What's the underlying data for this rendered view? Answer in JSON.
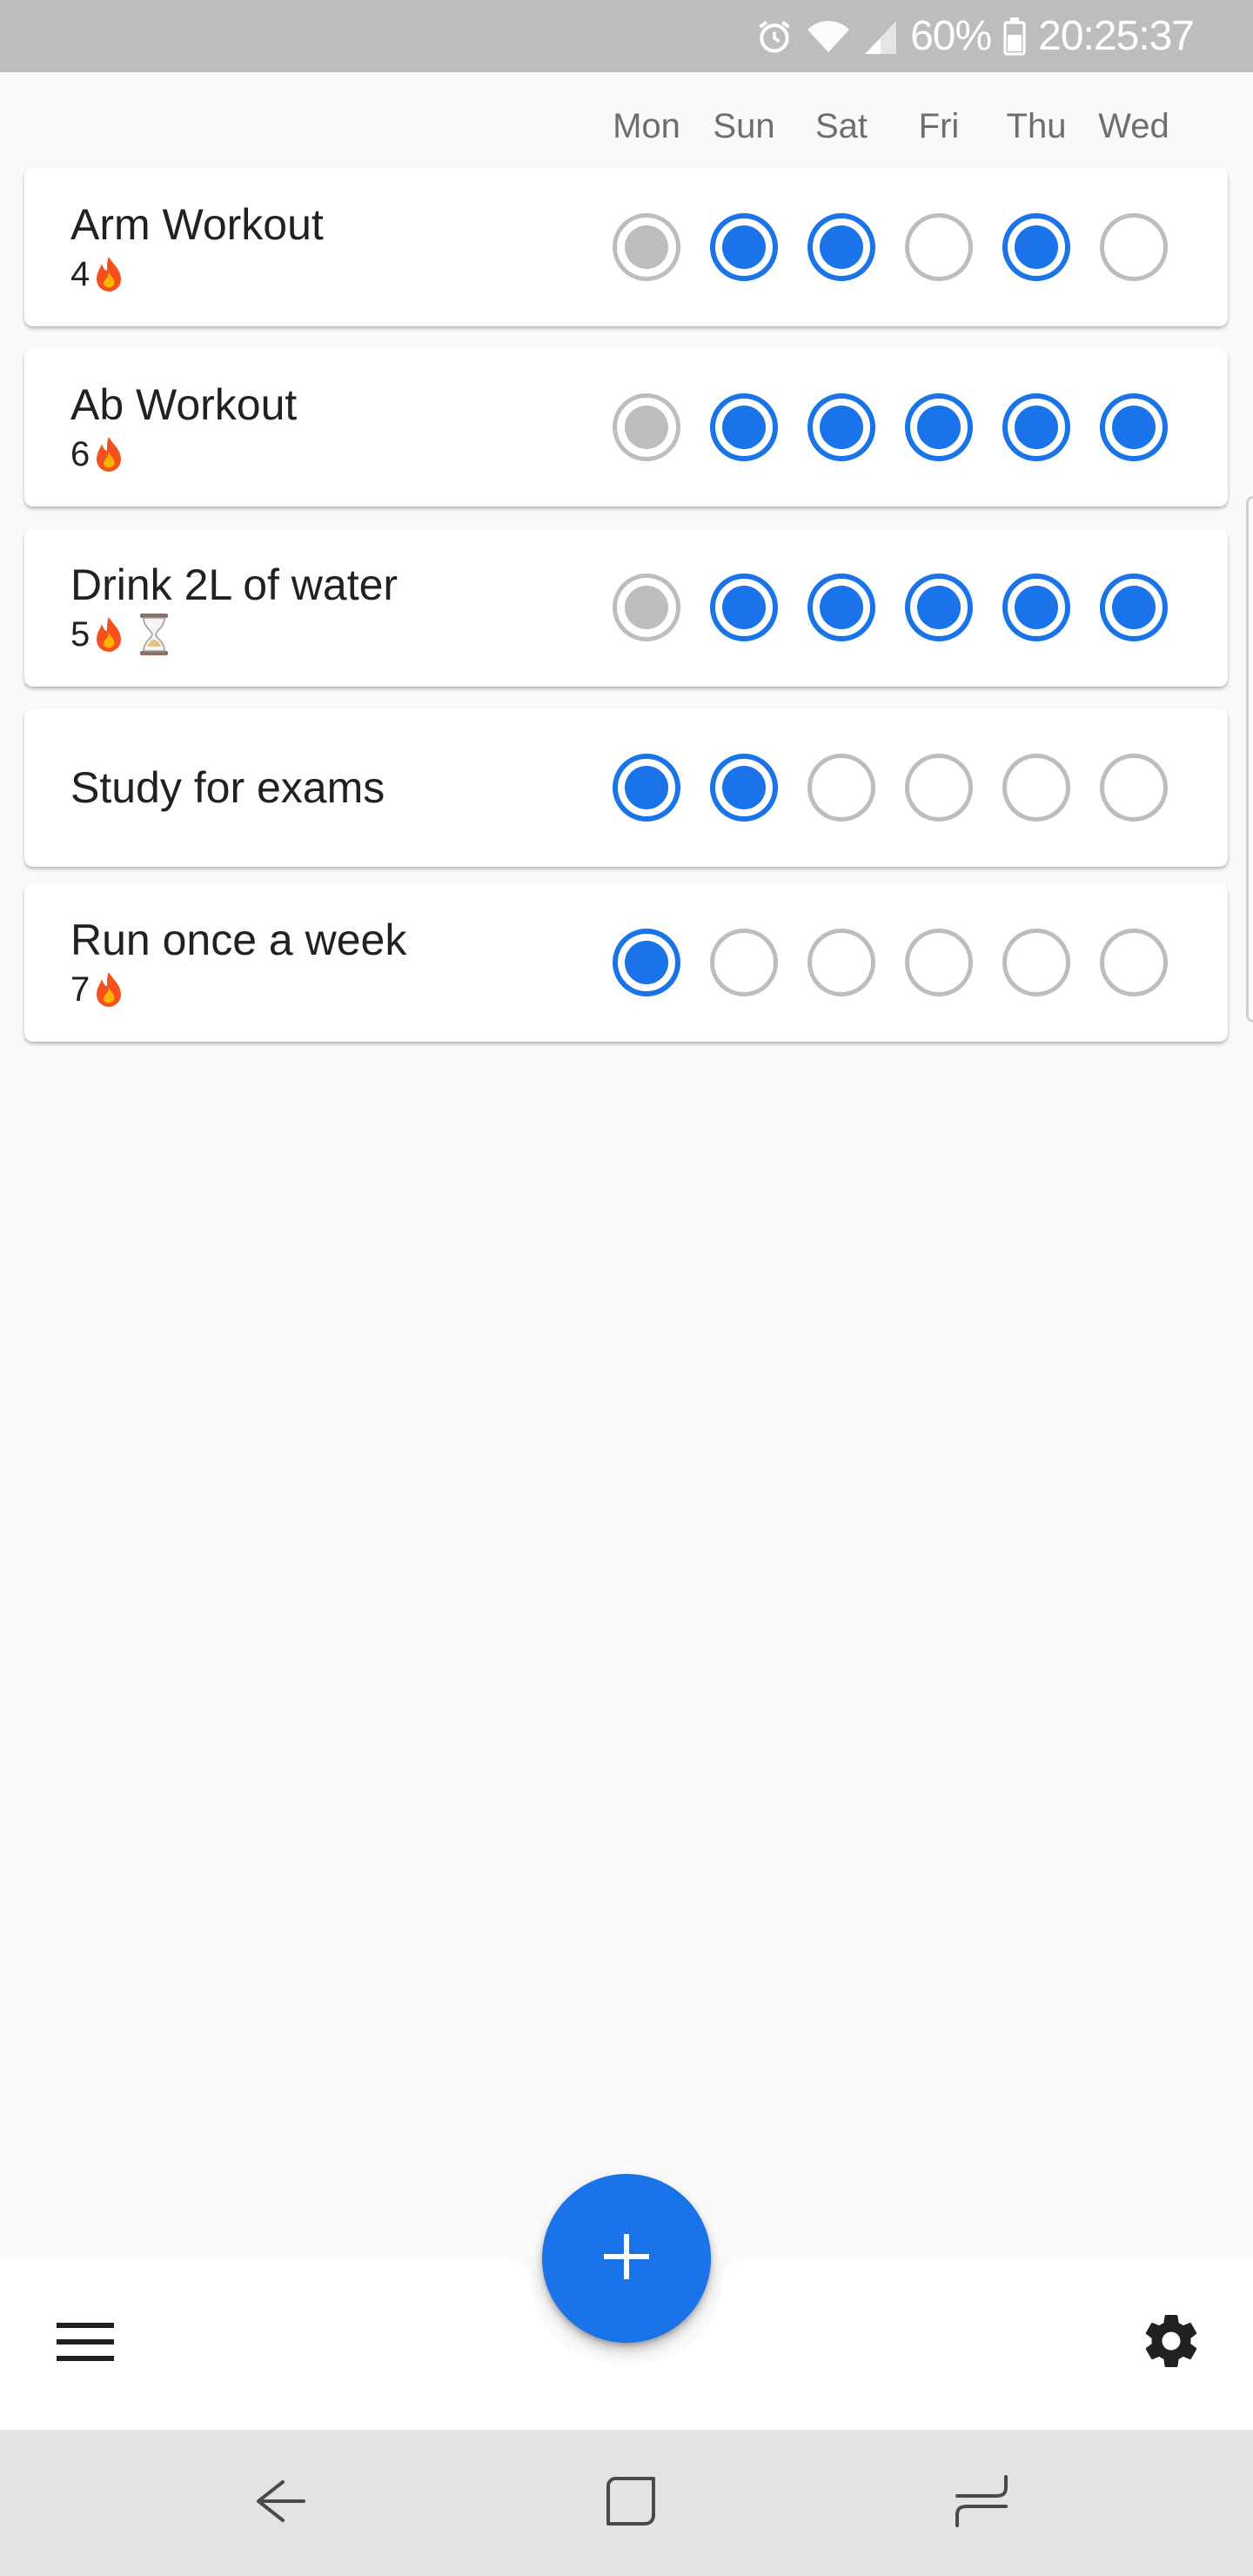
{
  "status_bar": {
    "battery_percent": "60%",
    "time": "20:25:37",
    "icons": [
      "alarm-icon",
      "wifi-icon",
      "signal-icon",
      "battery-icon"
    ]
  },
  "days": [
    "Mon",
    "Sun",
    "Sat",
    "Fri",
    "Thu",
    "Wed"
  ],
  "habits": [
    {
      "name": "Arm Workout",
      "streak": "4",
      "states": [
        "skipped",
        "done",
        "done",
        "empty",
        "done",
        "empty"
      ],
      "hourglass": false
    },
    {
      "name": "Ab Workout",
      "streak": "6",
      "states": [
        "skipped",
        "done",
        "done",
        "done",
        "done",
        "done"
      ],
      "hourglass": false
    },
    {
      "name": "Drink 2L of water",
      "streak": "5",
      "states": [
        "skipped",
        "done",
        "done",
        "done",
        "done",
        "done"
      ],
      "hourglass": true
    },
    {
      "name": "Study for exams",
      "streak": "",
      "states": [
        "done",
        "done",
        "empty",
        "empty",
        "empty",
        "empty"
      ],
      "hourglass": false
    },
    {
      "name": "Run once a week",
      "streak": "7",
      "states": [
        "done",
        "empty",
        "empty",
        "empty",
        "empty",
        "empty"
      ],
      "hourglass": false
    }
  ],
  "bottom_bar": {
    "menu_icon": "hamburger-menu-icon",
    "add_icon": "plus-icon",
    "settings_icon": "gear-icon"
  },
  "nav_bar": {
    "icons": [
      "back-icon",
      "home-icon",
      "recents-icon"
    ]
  },
  "colors": {
    "accent": "#1a73e8",
    "inactive": "#bdbdbd",
    "status_bar": "#bdbdbd",
    "background": "#fafafa",
    "nav_bar": "#e3e3e3"
  }
}
